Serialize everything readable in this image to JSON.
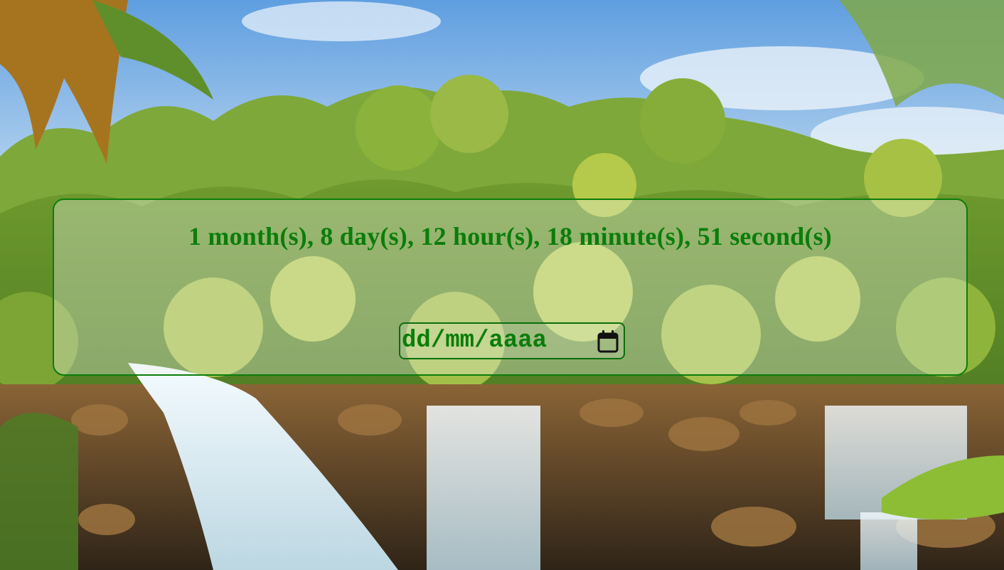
{
  "countdown": {
    "text": "1 month(s), 8 day(s), 12 hour(s), 18 minute(s), 51 second(s)"
  },
  "date_input": {
    "placeholder": "dd/mm/aaaa",
    "icon": "calendar-icon"
  },
  "background": {
    "scene": "tropical-waterfall",
    "colors": {
      "sky": "#7fb6e6",
      "foliage": "#8fb43a",
      "rock": "#7a5a34",
      "water": "#e8f2f6"
    }
  },
  "accent_color": "#0a7d0a"
}
